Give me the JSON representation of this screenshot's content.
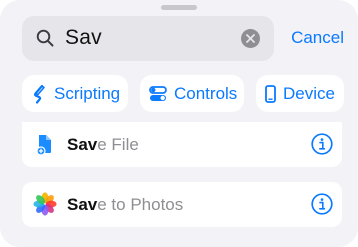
{
  "search": {
    "value": "Sav",
    "clear_icon": "xmark-circle-icon",
    "cancel_label": "Cancel"
  },
  "chips": [
    {
      "label": "Scripting",
      "icon": "scripting-icon"
    },
    {
      "label": "Controls",
      "icon": "toggles-icon"
    },
    {
      "label": "Device",
      "icon": "phone-icon"
    }
  ],
  "results": [
    {
      "match": "Sav",
      "rest": "e File",
      "icon": "file-icon",
      "info_icon": "info-icon"
    },
    {
      "match": "Sav",
      "rest": "e to Photos",
      "icon": "photos-icon",
      "info_icon": "info-icon"
    }
  ],
  "colors": {
    "accent": "#0a7aff",
    "sheet_bg": "#f2f2f7",
    "field_bg": "#e5e5ea",
    "muted_text": "#8e8e93"
  }
}
